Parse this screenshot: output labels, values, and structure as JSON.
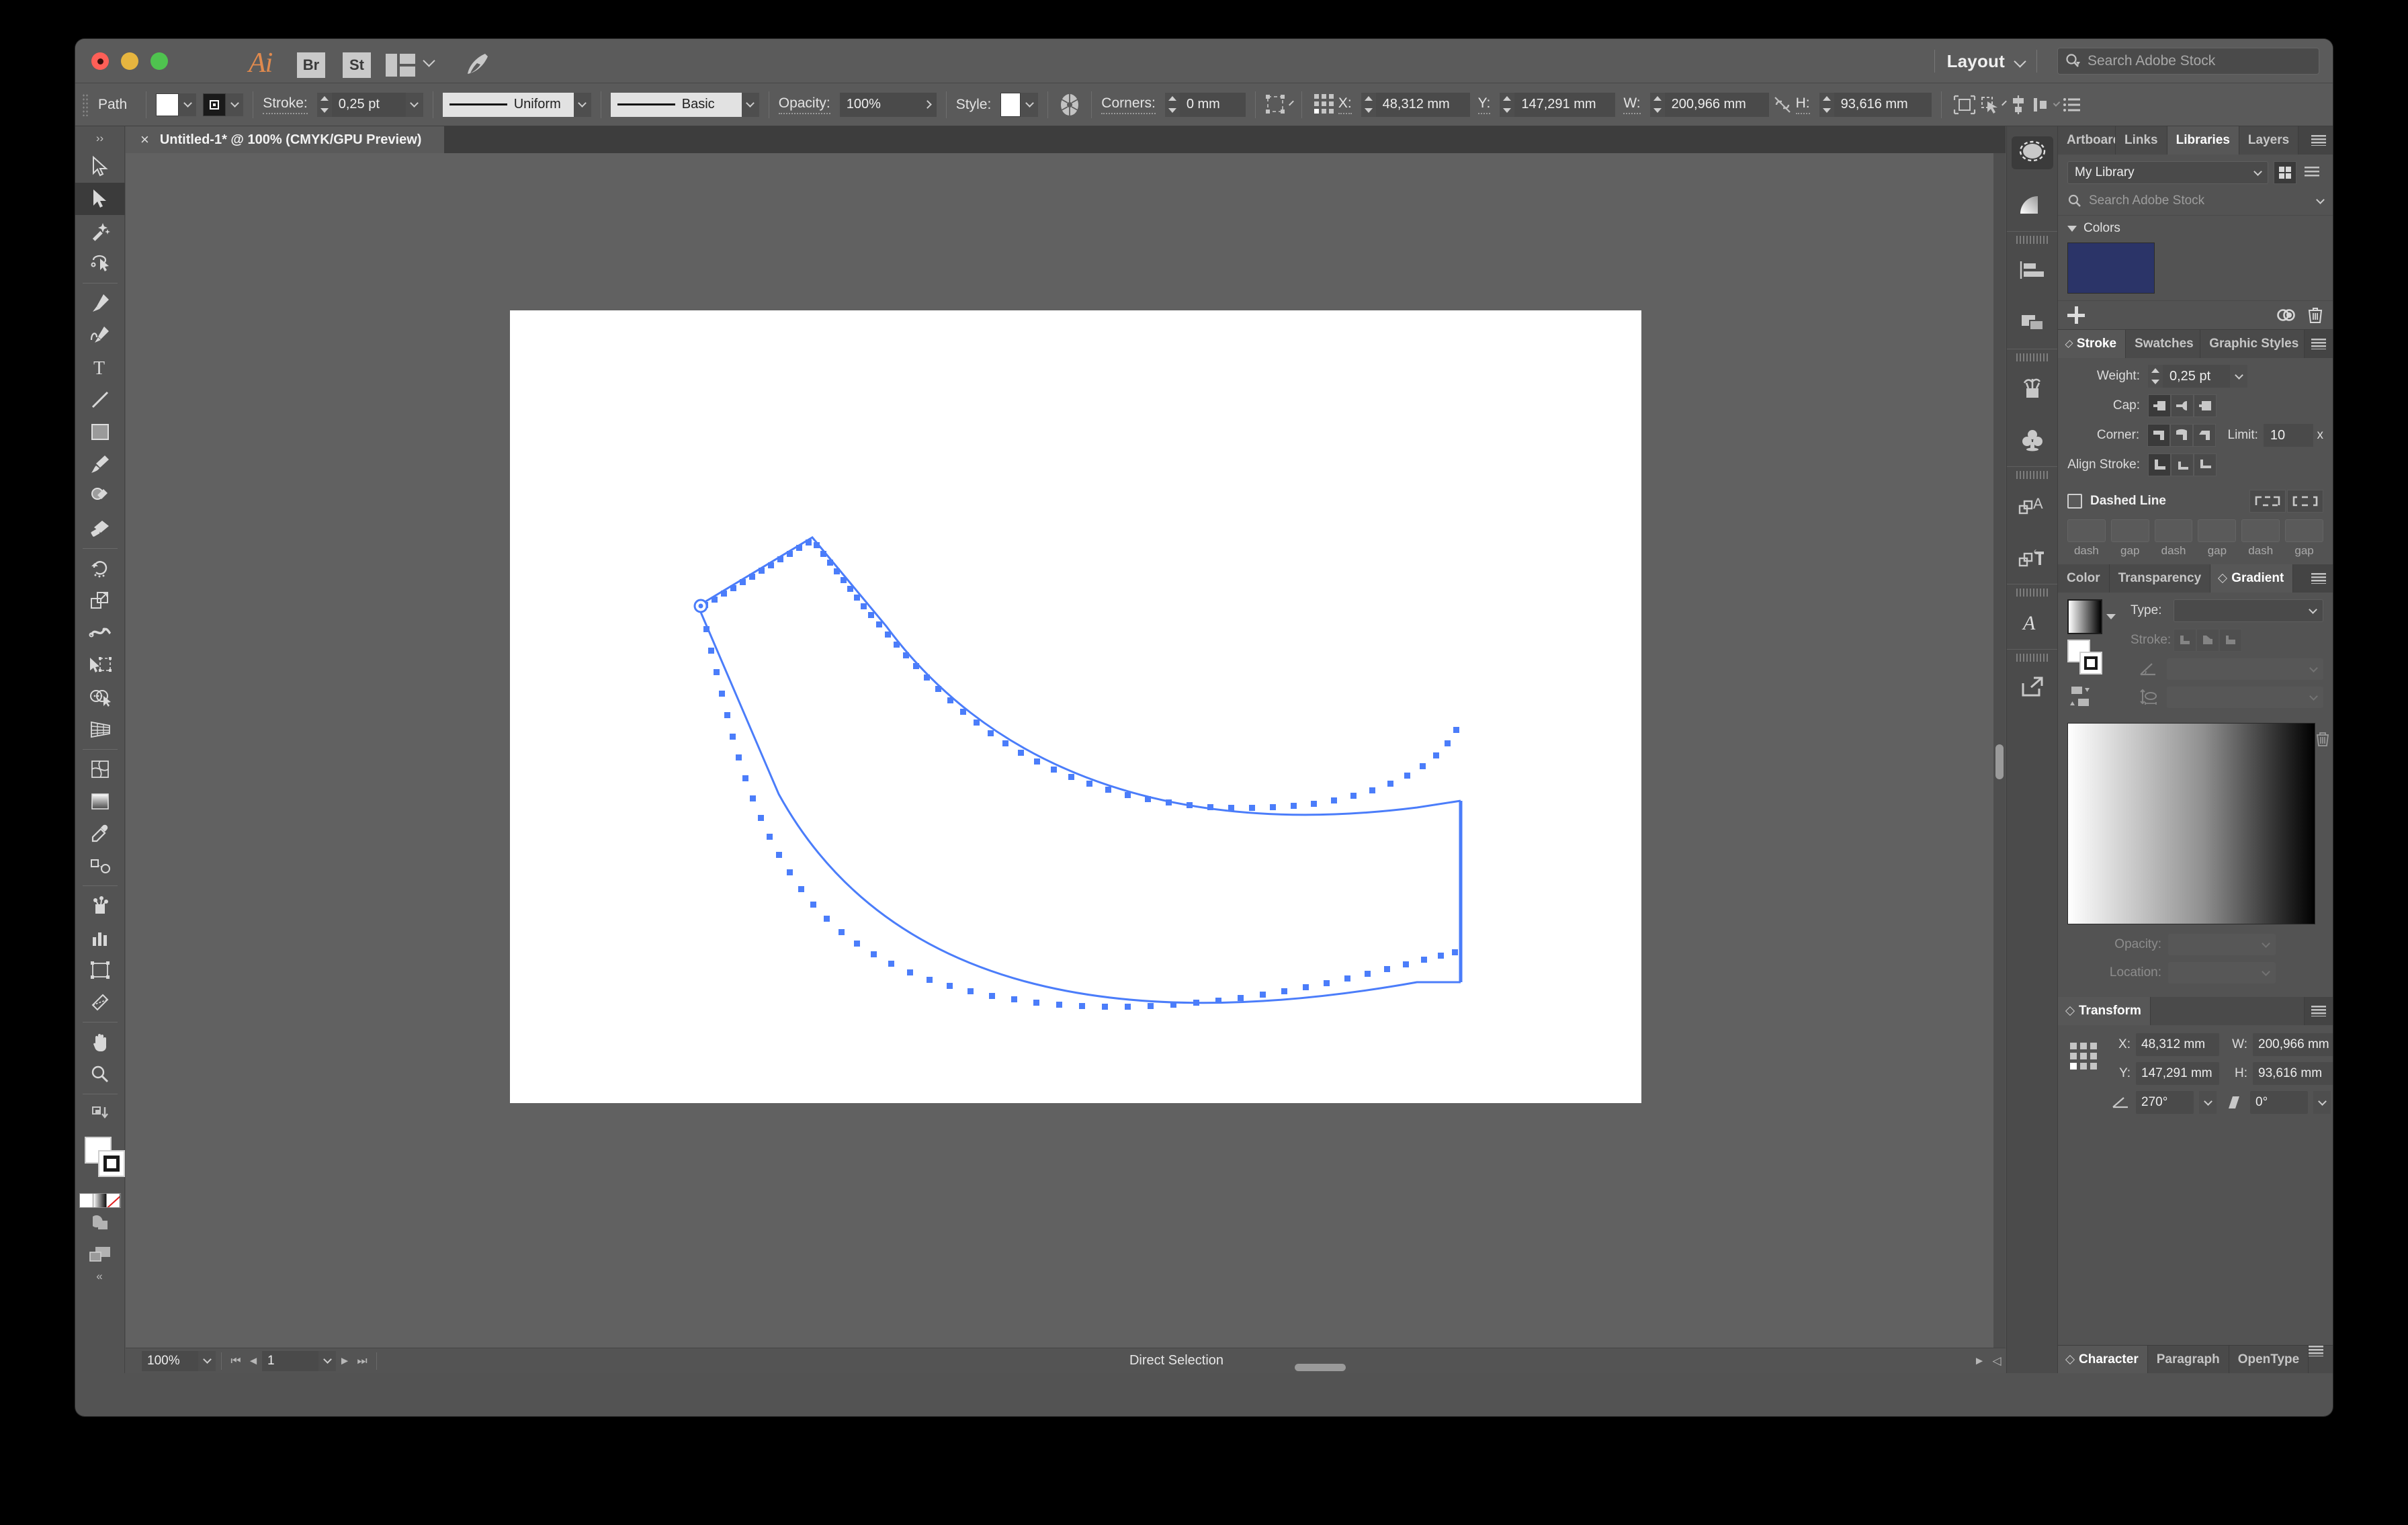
{
  "titlebar": {
    "app_icon": "illustrator-ai-logo",
    "bridge_label": "Br",
    "stock_label": "St",
    "workspace_label": "Layout",
    "search_placeholder": "Search Adobe Stock"
  },
  "control_bar": {
    "object_type": "Path",
    "stroke_label": "Stroke:",
    "stroke_weight": "0,25 pt",
    "profile": "Uniform",
    "brush": "Basic",
    "opacity_label": "Opacity:",
    "opacity_value": "100%",
    "style_label": "Style:",
    "corners_label": "Corners:",
    "corners_value": "0 mm",
    "x_label": "X:",
    "x_value": "48,312 mm",
    "y_label": "Y:",
    "y_value": "147,291 mm",
    "w_label": "W:",
    "w_value": "200,966 mm",
    "h_label": "H:",
    "h_value": "93,616 mm"
  },
  "document": {
    "tab_title": "Untitled-1* @ 100% (CMYK/GPU Preview)",
    "close_glyph": "×"
  },
  "status_bar": {
    "zoom": "100%",
    "page": "1",
    "tool_status": "Direct Selection"
  },
  "toolbar": {
    "collapse_glyph": "››",
    "expand_glyph": "«",
    "tools": [
      {
        "name": "selection-tool",
        "active": false
      },
      {
        "name": "direct-selection-tool",
        "active": true
      },
      {
        "name": "magic-wand-tool",
        "active": false
      },
      {
        "name": "lasso-tool",
        "active": false
      },
      {
        "name": "pen-tool",
        "active": false
      },
      {
        "name": "curvature-tool",
        "active": false
      },
      {
        "name": "type-tool",
        "active": false
      },
      {
        "name": "line-segment-tool",
        "active": false
      },
      {
        "name": "rectangle-tool",
        "active": false
      },
      {
        "name": "paintbrush-tool",
        "active": false
      },
      {
        "name": "shaper-tool",
        "active": false
      },
      {
        "name": "blob-brush-tool",
        "active": false
      },
      {
        "name": "eraser-tool",
        "active": false
      },
      {
        "name": "rotate-tool",
        "active": false
      },
      {
        "name": "scale-tool",
        "active": false
      },
      {
        "name": "width-tool",
        "active": false
      },
      {
        "name": "free-transform-tool",
        "active": false
      },
      {
        "name": "shape-builder-tool",
        "active": false
      },
      {
        "name": "perspective-grid-tool",
        "active": false
      },
      {
        "name": "mesh-tool",
        "active": false
      },
      {
        "name": "gradient-tool",
        "active": false
      },
      {
        "name": "eyedropper-tool",
        "active": false
      },
      {
        "name": "blend-tool",
        "active": false
      },
      {
        "name": "symbol-sprayer-tool",
        "active": false
      },
      {
        "name": "column-graph-tool",
        "active": false
      },
      {
        "name": "artboard-tool",
        "active": false
      },
      {
        "name": "slice-tool",
        "active": false
      },
      {
        "name": "hand-tool",
        "active": false
      },
      {
        "name": "zoom-tool",
        "active": false
      }
    ],
    "fill_color": "#ffffff",
    "stroke_color": "#000000",
    "mini_swatches": [
      "color",
      "gradient",
      "none"
    ]
  },
  "panels": {
    "library_tabs": [
      {
        "label": "Artboards",
        "active": false
      },
      {
        "label": "Links",
        "active": false
      },
      {
        "label": "Libraries",
        "active": true
      },
      {
        "label": "Layers",
        "active": false
      }
    ],
    "library_select": "My Library",
    "library_search_placeholder": "Search Adobe Stock",
    "colors_group_label": "Colors",
    "color_swatch_hex": "#2b3468",
    "stroke_tabs": [
      {
        "label": "Stroke",
        "active": true
      },
      {
        "label": "Swatches",
        "active": false
      },
      {
        "label": "Graphic Styles",
        "active": false
      }
    ],
    "stroke": {
      "weight_label": "Weight:",
      "weight_value": "0,25 pt",
      "cap_label": "Cap:",
      "corner_label": "Corner:",
      "limit_label": "Limit:",
      "limit_value": "10",
      "limit_unit": "x",
      "align_label": "Align Stroke:",
      "dashed_label": "Dashed Line",
      "dash_fields": [
        "dash",
        "gap",
        "dash",
        "gap",
        "dash",
        "gap"
      ]
    },
    "color_tabs": [
      {
        "label": "Color",
        "active": false
      },
      {
        "label": "Transparency",
        "active": false
      },
      {
        "label": "Gradient",
        "active": true
      }
    ],
    "gradient": {
      "type_label": "Type:",
      "type_value": "",
      "stroke_label": "Stroke:",
      "angle_value": "",
      "aspect_value": "",
      "opacity_label": "Opacity:",
      "opacity_value": "",
      "location_label": "Location:",
      "location_value": ""
    },
    "transform_tabs": [
      {
        "label": "Transform",
        "active": true
      }
    ],
    "transform": {
      "x_label": "X:",
      "x_value": "48,312 mm",
      "y_label": "Y:",
      "y_value": "147,291 mm",
      "w_label": "W:",
      "w_value": "200,966 mm",
      "h_label": "H:",
      "h_value": "93,616 mm",
      "rotate_value": "270°",
      "shear_value": "0°"
    },
    "character_tabs": [
      {
        "label": "Character",
        "active": true
      },
      {
        "label": "Paragraph",
        "active": false
      },
      {
        "label": "OpenType",
        "active": false
      }
    ]
  },
  "icon_rail": [
    {
      "name": "selection-marquee-icon",
      "active": true
    },
    {
      "name": "gradient-fan-icon",
      "active": false
    },
    {
      "name": "align-icon",
      "active": false
    },
    {
      "name": "pathfinder-icon",
      "active": false
    },
    {
      "name": "brushes-icon",
      "active": false
    },
    {
      "name": "symbols-icon",
      "active": false
    },
    {
      "name": "character-styles-icon",
      "active": false
    },
    {
      "name": "paragraph-styles-icon",
      "active": false
    },
    {
      "name": "glyphs-icon",
      "active": false
    },
    {
      "name": "asset-export-icon",
      "active": false
    }
  ],
  "artwork": {
    "selection_color": "#4b7dfa",
    "shape_description": "curved-banner-path-with-anchor-points"
  }
}
